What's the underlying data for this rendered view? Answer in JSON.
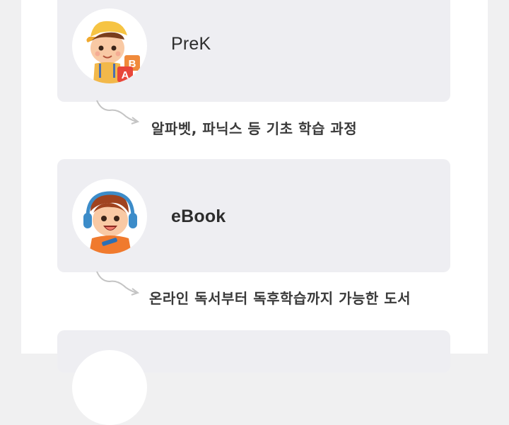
{
  "courses": [
    {
      "title": "PreK",
      "description": "알파벳, 파닉스 등 기초 학습 과정",
      "avatar_icon": "boy-with-abc-blocks-icon"
    },
    {
      "title": "eBook",
      "description": "온라인 독서부터 독후학습까지 가능한 도서",
      "avatar_icon": "boy-with-headphones-icon"
    },
    {
      "title": "",
      "description": "",
      "avatar_icon": "avatar-icon"
    }
  ],
  "colors": {
    "background": "#f0f0f1",
    "card": "#eeeef2",
    "connector": "#c4c4c4",
    "text": "#2d2d2d"
  }
}
